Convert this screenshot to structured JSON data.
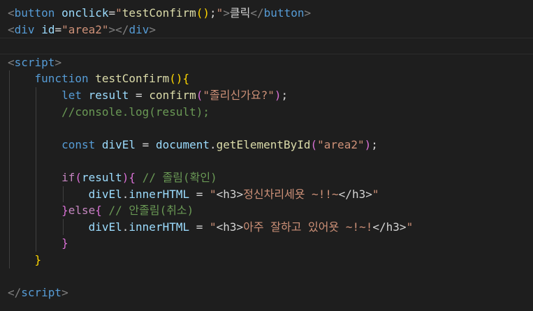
{
  "editor": {
    "language": "html",
    "theme_colors": {
      "background": "#1e1e1e",
      "tag_bracket": "#808080",
      "tag_name": "#569cd6",
      "attribute": "#9cdcfe",
      "string": "#ce9178",
      "keyword": "#569cd6",
      "control": "#c586c0",
      "function": "#dcdcaa",
      "comment": "#6a9955",
      "bracket_level1": "#ffd700",
      "bracket_level2": "#da70d6",
      "bracket_level3": "#179fff"
    },
    "lines": [
      {
        "tokens": [
          {
            "t": "<",
            "c": "tag"
          },
          {
            "t": "button",
            "c": "tagname"
          },
          {
            "t": " ",
            "c": "txt"
          },
          {
            "t": "onclick",
            "c": "attr"
          },
          {
            "t": "=",
            "c": "txt"
          },
          {
            "t": "\"",
            "c": "str"
          },
          {
            "t": "testConfirm",
            "c": "fn"
          },
          {
            "t": "()",
            "c": "b1"
          },
          {
            "t": ";",
            "c": "txt"
          },
          {
            "t": "\"",
            "c": "str"
          },
          {
            "t": ">",
            "c": "tag"
          },
          {
            "t": "클릭",
            "c": "txt"
          },
          {
            "t": "</",
            "c": "tag"
          },
          {
            "t": "button",
            "c": "tagname"
          },
          {
            "t": ">",
            "c": "tag"
          }
        ]
      },
      {
        "tokens": [
          {
            "t": "<",
            "c": "tag"
          },
          {
            "t": "div",
            "c": "tagname"
          },
          {
            "t": " ",
            "c": "txt"
          },
          {
            "t": "id",
            "c": "attr"
          },
          {
            "t": "=",
            "c": "txt"
          },
          {
            "t": "\"area2\"",
            "c": "str"
          },
          {
            "t": ">",
            "c": "tag"
          },
          {
            "t": "</",
            "c": "tag"
          },
          {
            "t": "div",
            "c": "tagname"
          },
          {
            "t": ">",
            "c": "tag"
          }
        ]
      },
      {
        "tokens": [],
        "current": true
      },
      {
        "tokens": [
          {
            "t": "<",
            "c": "tag"
          },
          {
            "t": "script",
            "c": "tagname"
          },
          {
            "t": ">",
            "c": "tag"
          }
        ]
      },
      {
        "tokens": [
          {
            "t": "    ",
            "c": "txt"
          },
          {
            "t": "function",
            "c": "kw"
          },
          {
            "t": " ",
            "c": "txt"
          },
          {
            "t": "testConfirm",
            "c": "fn"
          },
          {
            "t": "()",
            "c": "b1"
          },
          {
            "t": "{",
            "c": "b1"
          }
        ]
      },
      {
        "tokens": [
          {
            "t": "        ",
            "c": "txt"
          },
          {
            "t": "let",
            "c": "kw"
          },
          {
            "t": " ",
            "c": "txt"
          },
          {
            "t": "result",
            "c": "var"
          },
          {
            "t": " = ",
            "c": "txt"
          },
          {
            "t": "confirm",
            "c": "fn"
          },
          {
            "t": "(",
            "c": "b2"
          },
          {
            "t": "\"졸리신가요?\"",
            "c": "str"
          },
          {
            "t": ")",
            "c": "b2"
          },
          {
            "t": ";",
            "c": "txt"
          }
        ]
      },
      {
        "tokens": [
          {
            "t": "        ",
            "c": "txt"
          },
          {
            "t": "//console.log(result);",
            "c": "cmt"
          }
        ]
      },
      {
        "tokens": []
      },
      {
        "tokens": [
          {
            "t": "        ",
            "c": "txt"
          },
          {
            "t": "const",
            "c": "kw"
          },
          {
            "t": " ",
            "c": "txt"
          },
          {
            "t": "divEl",
            "c": "var"
          },
          {
            "t": " = ",
            "c": "txt"
          },
          {
            "t": "document",
            "c": "var"
          },
          {
            "t": ".",
            "c": "txt"
          },
          {
            "t": "getElementById",
            "c": "fn"
          },
          {
            "t": "(",
            "c": "b2"
          },
          {
            "t": "\"area2\"",
            "c": "str"
          },
          {
            "t": ")",
            "c": "b2"
          },
          {
            "t": ";",
            "c": "txt"
          }
        ]
      },
      {
        "tokens": []
      },
      {
        "tokens": [
          {
            "t": "        ",
            "c": "txt"
          },
          {
            "t": "if",
            "c": "ctrl"
          },
          {
            "t": "(",
            "c": "b2"
          },
          {
            "t": "result",
            "c": "var"
          },
          {
            "t": ")",
            "c": "b2"
          },
          {
            "t": "{",
            "c": "b2"
          },
          {
            "t": " ",
            "c": "txt"
          },
          {
            "t": "// 졸림(확인)",
            "c": "cmt"
          }
        ]
      },
      {
        "tokens": [
          {
            "t": "            ",
            "c": "txt"
          },
          {
            "t": "divEl",
            "c": "var"
          },
          {
            "t": ".",
            "c": "txt"
          },
          {
            "t": "innerHTML",
            "c": "var"
          },
          {
            "t": " = ",
            "c": "txt"
          },
          {
            "t": "\"",
            "c": "str"
          },
          {
            "t": "<h3>",
            "c": "txt"
          },
          {
            "t": "정신차리세욧 ~!!~",
            "c": "str"
          },
          {
            "t": "</h3>",
            "c": "txt"
          },
          {
            "t": "\"",
            "c": "str"
          }
        ]
      },
      {
        "tokens": [
          {
            "t": "        ",
            "c": "txt"
          },
          {
            "t": "}",
            "c": "b2"
          },
          {
            "t": "else",
            "c": "ctrl"
          },
          {
            "t": "{",
            "c": "b2"
          },
          {
            "t": " ",
            "c": "txt"
          },
          {
            "t": "// 안졸림(취소)",
            "c": "cmt"
          }
        ]
      },
      {
        "tokens": [
          {
            "t": "            ",
            "c": "txt"
          },
          {
            "t": "divEl",
            "c": "var"
          },
          {
            "t": ".",
            "c": "txt"
          },
          {
            "t": "innerHTML",
            "c": "var"
          },
          {
            "t": " = ",
            "c": "txt"
          },
          {
            "t": "\"",
            "c": "str"
          },
          {
            "t": "<h3>",
            "c": "txt"
          },
          {
            "t": "아주 잘하고 있어욧 ~!~!",
            "c": "str"
          },
          {
            "t": "</h3>",
            "c": "txt"
          },
          {
            "t": "\"",
            "c": "str"
          }
        ]
      },
      {
        "tokens": [
          {
            "t": "        ",
            "c": "txt"
          },
          {
            "t": "}",
            "c": "b2"
          }
        ]
      },
      {
        "tokens": [
          {
            "t": "    ",
            "c": "txt"
          },
          {
            "t": "}",
            "c": "b1"
          }
        ]
      },
      {
        "tokens": []
      },
      {
        "tokens": [
          {
            "t": "</",
            "c": "tag"
          },
          {
            "t": "script",
            "c": "tagname"
          },
          {
            "t": ">",
            "c": "tag"
          }
        ]
      }
    ]
  }
}
